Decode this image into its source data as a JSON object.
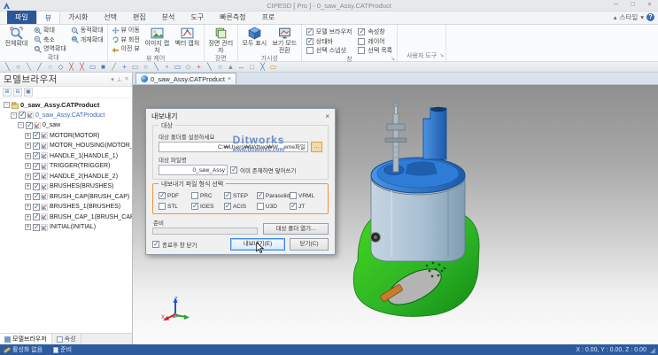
{
  "window": {
    "title": "CIPESD [ Pro ] - 0_saw_Assy.CATProduct",
    "style_label": "스타일",
    "minimize": "─",
    "maximize": "□",
    "close": "×",
    "collapse_glyph": "▴",
    "dropdown_glyph": "▾",
    "help_glyph": "?"
  },
  "menu_tabs": [
    {
      "id": "file",
      "label": "파일",
      "file": true,
      "active": false
    },
    {
      "id": "view",
      "label": "뷰",
      "file": false,
      "active": true
    },
    {
      "id": "visualize",
      "label": "가시화",
      "file": false,
      "active": false
    },
    {
      "id": "select",
      "label": "선택",
      "file": false,
      "active": false
    },
    {
      "id": "edit",
      "label": "편집",
      "file": false,
      "active": false
    },
    {
      "id": "analyze",
      "label": "분석",
      "file": false,
      "active": false
    },
    {
      "id": "tools",
      "label": "도구",
      "file": false,
      "active": false
    },
    {
      "id": "quick-measure",
      "label": "빠른측정",
      "file": false,
      "active": false
    },
    {
      "id": "pro",
      "label": "프로",
      "file": false,
      "active": false
    }
  ],
  "ribbon": {
    "groups": [
      {
        "label": "확대",
        "launcher": false,
        "blocks": [
          {
            "type": "big",
            "items": [
              {
                "label": "전체확대",
                "icon": "zoom-fit"
              }
            ]
          },
          {
            "type": "stack",
            "items": [
              {
                "label": "확대",
                "icon": "zoom-in"
              },
              {
                "label": "축소",
                "icon": "zoom-out"
              },
              {
                "label": "영역확대",
                "icon": "zoom-area"
              }
            ]
          },
          {
            "type": "stack",
            "items": [
              {
                "label": "동적확대",
                "icon": "zoom-dynamic"
              },
              {
                "label": "개체확대",
                "icon": "zoom-object"
              }
            ]
          }
        ]
      },
      {
        "label": "뷰 제어",
        "launcher": false,
        "blocks": [
          {
            "type": "stack",
            "items": [
              {
                "label": "뷰 이동",
                "icon": "pan"
              },
              {
                "label": "뷰 회전",
                "icon": "rotate"
              },
              {
                "label": "이전 뷰",
                "icon": "prev-view"
              }
            ]
          },
          {
            "type": "big",
            "items": [
              {
                "label": "이미지 캡처",
                "icon": "capture-image"
              },
              {
                "label": "벡터 캡처",
                "icon": "capture-vector"
              }
            ]
          }
        ]
      },
      {
        "label": "장면",
        "launcher": false,
        "blocks": [
          {
            "type": "big",
            "items": [
              {
                "label": "장면 관리자",
                "icon": "scene-manager"
              }
            ]
          }
        ]
      },
      {
        "label": "가시성",
        "launcher": false,
        "blocks": [
          {
            "type": "big",
            "items": [
              {
                "label": "모두 표시",
                "icon": "show-all"
              },
              {
                "label": "보기 모드 전환",
                "icon": "view-mode"
              }
            ]
          }
        ]
      },
      {
        "label": "창",
        "launcher": true,
        "blocks": [
          {
            "type": "checks",
            "items": [
              {
                "label": "모델 브라우저",
                "checked": true
              },
              {
                "label": "상태바",
                "checked": true
              },
              {
                "label": "선택 스냅샷",
                "checked": false
              }
            ]
          },
          {
            "type": "checks",
            "items": [
              {
                "label": "속성창",
                "checked": true
              },
              {
                "label": "레이어",
                "checked": false
              },
              {
                "label": "선택 목록",
                "checked": false
              }
            ]
          }
        ]
      },
      {
        "label": "사용자 도구",
        "launcher": true,
        "blocks": []
      }
    ]
  },
  "quickbar": {
    "icons": [
      {
        "name": "select-tool",
        "g": "╲",
        "c": "#4a7ab5"
      },
      {
        "name": "circle-tool",
        "g": "○",
        "c": "#4a7ab5"
      },
      {
        "name": "line-tool",
        "g": "╲",
        "c": "#8a9096"
      },
      {
        "name": "diag-tool",
        "g": "╱",
        "c": "#4a7ab5"
      },
      {
        "name": "ellipse-tool",
        "g": "○",
        "c": "#8a9096"
      },
      {
        "name": "poly-tool",
        "g": "◇",
        "c": "#4a7ab5"
      },
      {
        "name": "delete-tool",
        "g": "╳",
        "c": "#c0504d"
      },
      {
        "name": "erase-tool",
        "g": "╳",
        "c": "#c0504d"
      },
      {
        "name": "rect-tool",
        "g": "▭",
        "c": "#4a7ab5"
      },
      {
        "name": "fill-tool",
        "g": "■",
        "c": "#4a7ab5"
      },
      {
        "name": "slash-tool",
        "g": "╱",
        "c": "#8a9096"
      },
      {
        "name": "add-tool",
        "g": "+",
        "c": "#4a7ab5"
      },
      {
        "name": "frame-tool",
        "g": "▭",
        "c": "#8a9096"
      },
      {
        "name": "ring-tool",
        "g": "○",
        "c": "#4a7ab5"
      },
      {
        "name": "measure-tool",
        "g": "╲",
        "c": "#4a7ab5"
      },
      {
        "name": "point-tool",
        "g": "•",
        "c": "#8a9096"
      },
      {
        "name": "box-tool",
        "g": "▭",
        "c": "#4a7ab5"
      },
      {
        "name": "gem-tool",
        "g": "◇",
        "c": "#8a9096"
      },
      {
        "name": "plus-tool",
        "g": "+",
        "c": "#c0504d"
      },
      {
        "name": "slope-tool",
        "g": "╲",
        "c": "#4a7ab5"
      },
      {
        "name": "round-tool",
        "g": "○",
        "c": "#4a7ab5"
      },
      {
        "name": "tri-tool",
        "g": "▲",
        "c": "#8a9096"
      },
      {
        "name": "arrow-tool",
        "g": "↔",
        "c": "#4a7ab5"
      },
      {
        "name": "square-tool",
        "g": "□",
        "c": "#8a9096"
      },
      {
        "name": "cross-tool",
        "g": "╳",
        "c": "#4a7ab5"
      },
      {
        "name": "clip-tool",
        "g": "▭",
        "c": "#d28a2e"
      }
    ]
  },
  "browser": {
    "title": "모델브라우저",
    "header_buttons": [
      "▾",
      "⊥",
      "×"
    ],
    "tools": [
      "⊞",
      "⊟",
      "▣"
    ],
    "tree": [
      {
        "l": 0,
        "label": "0_saw_Assy.CATProduct",
        "cls": "root",
        "exp": "-",
        "chk": null,
        "icon": "assembly"
      },
      {
        "l": 1,
        "label": "0_saw_Assy.CATProduct",
        "cls": "link",
        "exp": "-",
        "chk": true,
        "icon": "part"
      },
      {
        "l": 2,
        "label": "0_saw",
        "cls": "",
        "exp": "-",
        "chk": true,
        "icon": "part"
      },
      {
        "l": 3,
        "label": "MOTOR(MOTOR)",
        "cls": "",
        "exp": "+",
        "chk": true,
        "icon": "part"
      },
      {
        "l": 3,
        "label": "MOTOR_HOUSING(MOTOR_HOUSING)",
        "cls": "",
        "exp": "+",
        "chk": true,
        "icon": "part"
      },
      {
        "l": 3,
        "label": "HANDLE_1(HANDLE_1)",
        "cls": "",
        "exp": "+",
        "chk": true,
        "icon": "part"
      },
      {
        "l": 3,
        "label": "TRIGGER(TRIGGER)",
        "cls": "",
        "exp": "+",
        "chk": true,
        "icon": "part"
      },
      {
        "l": 3,
        "label": "HANDLE_2(HANDLE_2)",
        "cls": "",
        "exp": "+",
        "chk": true,
        "icon": "part"
      },
      {
        "l": 3,
        "label": "BRUSHES(BRUSHES)",
        "cls": "",
        "exp": "+",
        "chk": true,
        "icon": "part"
      },
      {
        "l": 3,
        "label": "BRUSH_CAP(BRUSH_CAP)",
        "cls": "",
        "exp": "+",
        "chk": true,
        "icon": "part"
      },
      {
        "l": 3,
        "label": "BRUSHES_1(BRUSHES)",
        "cls": "",
        "exp": "+",
        "chk": true,
        "icon": "part"
      },
      {
        "l": 3,
        "label": "BRUSH_CAP_1(BRUSH_CAP)",
        "cls": "",
        "exp": "+",
        "chk": true,
        "icon": "part"
      },
      {
        "l": 3,
        "label": "INITIAL(INITIAL)",
        "cls": "",
        "exp": "+",
        "chk": true,
        "icon": "part"
      }
    ],
    "tabs": [
      {
        "label": "모델브라우저",
        "active": true
      },
      {
        "label": "속성",
        "active": false
      }
    ]
  },
  "viewport": {
    "doc_tab": "0_saw_Assy.CATProduct",
    "doc_tab_close": "×",
    "axis_labels": {
      "x": "X",
      "y": "Y",
      "z": "Z"
    },
    "model_colors": {
      "cap_blue": "#2e7cd6",
      "body_blue": "#a9c0d2",
      "housing_green": "#2db227",
      "trigger_orange": "#c87a2e",
      "bolt_gray": "#aeb9c2"
    }
  },
  "dialog": {
    "title": "내보내기",
    "close_glyph": "×",
    "target_group": "대상",
    "folder_label": "대상 폴더를 설정하세요",
    "folder_value": "C:₩Users₩Wdtwo₩W…eme파일",
    "browse_label": "…",
    "filename_label": "대상 파일명",
    "filename_value": "0_saw_Assy",
    "overwrite_label": "이미 존재하면 덮어쓰기",
    "overwrite_checked": true,
    "format_group": "내보내기 파일 형식 선택",
    "formats": [
      {
        "label": "PDF",
        "checked": true
      },
      {
        "label": "PRC",
        "checked": false
      },
      {
        "label": "STEP",
        "checked": true
      },
      {
        "label": "Parasolid",
        "checked": true
      },
      {
        "label": "VRML",
        "checked": false
      },
      {
        "label": "STL",
        "checked": false
      },
      {
        "label": "IGES",
        "checked": true
      },
      {
        "label": "ACIS",
        "checked": true
      },
      {
        "label": "U3D",
        "checked": false
      },
      {
        "label": "JT",
        "checked": true
      }
    ],
    "progress_label": "준비",
    "open_folder_button": "대상 폴더 열기...",
    "close_after_label": "종료후 창 닫기",
    "close_after_checked": true,
    "export_button": "내보내기(E)",
    "close_button": "닫기(C)",
    "highlight_color": "#e8963c"
  },
  "watermark": {
    "brand": "Ditworks",
    "url": "www.ditworks.com"
  },
  "statusbar": {
    "active_label": "활성화 없음",
    "ready_label": "준비",
    "coords": "X : 0.00, Y : 0.00, Z : 0.00",
    "bar_color": "#2d5b9e"
  }
}
